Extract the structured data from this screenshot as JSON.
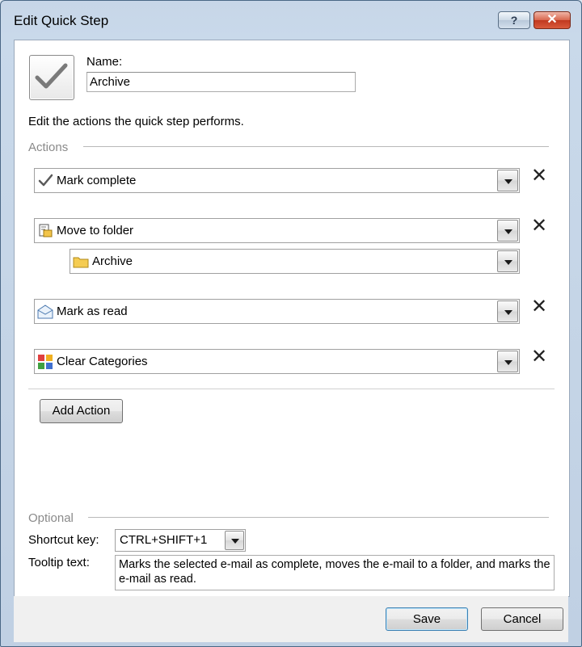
{
  "window": {
    "title": "Edit Quick Step",
    "help_label": "?",
    "close_label": "✕"
  },
  "name": {
    "label": "Name:",
    "value": "Archive"
  },
  "instructions": "Edit the actions the quick step performs.",
  "actions_section": {
    "label": "Actions"
  },
  "actions": [
    {
      "label": "Mark complete",
      "icon": "checkmark-icon"
    },
    {
      "label": "Move to folder",
      "icon": "move-to-folder-icon",
      "sub_value": "Archive",
      "sub_icon": "folder-icon"
    },
    {
      "label": "Mark as read",
      "icon": "envelope-icon"
    },
    {
      "label": "Clear Categories",
      "icon": "categories-icon"
    }
  ],
  "add_action_label": "Add Action",
  "optional_section": {
    "label": "Optional"
  },
  "shortcut": {
    "label": "Shortcut key:",
    "value": "CTRL+SHIFT+1"
  },
  "tooltip": {
    "label": "Tooltip text:",
    "value": "Marks the selected e-mail as complete, moves the e-mail to a folder, and marks the e-mail as read."
  },
  "buttons": {
    "save": "Save",
    "cancel": "Cancel"
  },
  "colors": {
    "title_bar": "#c7d6e8",
    "close_button": "#c0391f",
    "section_label": "#8a8a8a",
    "default_button_border": "#3c7fb1"
  }
}
